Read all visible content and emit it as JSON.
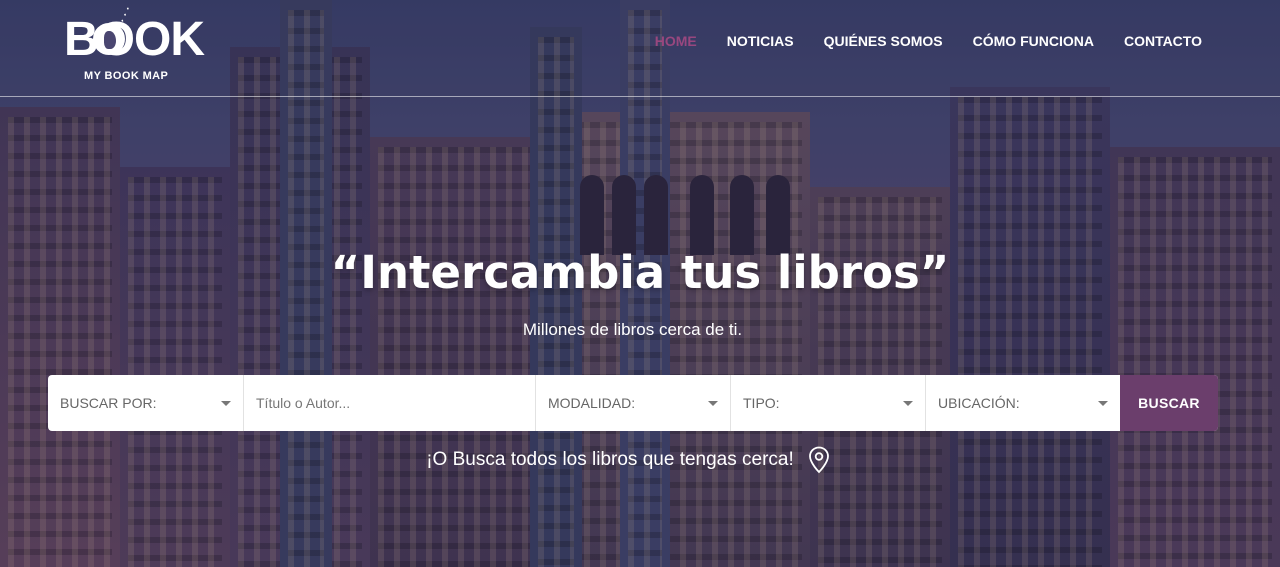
{
  "logo": {
    "word": "BOOK",
    "sub": "MY BOOK MAP"
  },
  "nav": {
    "items": [
      {
        "label": "HOME",
        "active": true
      },
      {
        "label": "NOTICIAS"
      },
      {
        "label": "QUIÉNES SOMOS"
      },
      {
        "label": "CÓMO FUNCIONA"
      },
      {
        "label": "CONTACTO"
      }
    ]
  },
  "hero": {
    "title": "“Intercambia tus libros”",
    "subtitle": "Millones de libros cerca de ti."
  },
  "search": {
    "buscar_por": "BUSCAR POR:",
    "query_placeholder": "Título o Autor...",
    "modalidad": "MODALIDAD:",
    "tipo": "TIPO:",
    "ubicacion": "UBICACIÓN:",
    "button": "BUSCAR"
  },
  "nearby": {
    "text": "¡O Busca todos los libros que tengas cerca!",
    "icon": "map-pin-icon"
  },
  "colors": {
    "accent": "#6b3e6c",
    "nav_active": "#b94b88"
  }
}
